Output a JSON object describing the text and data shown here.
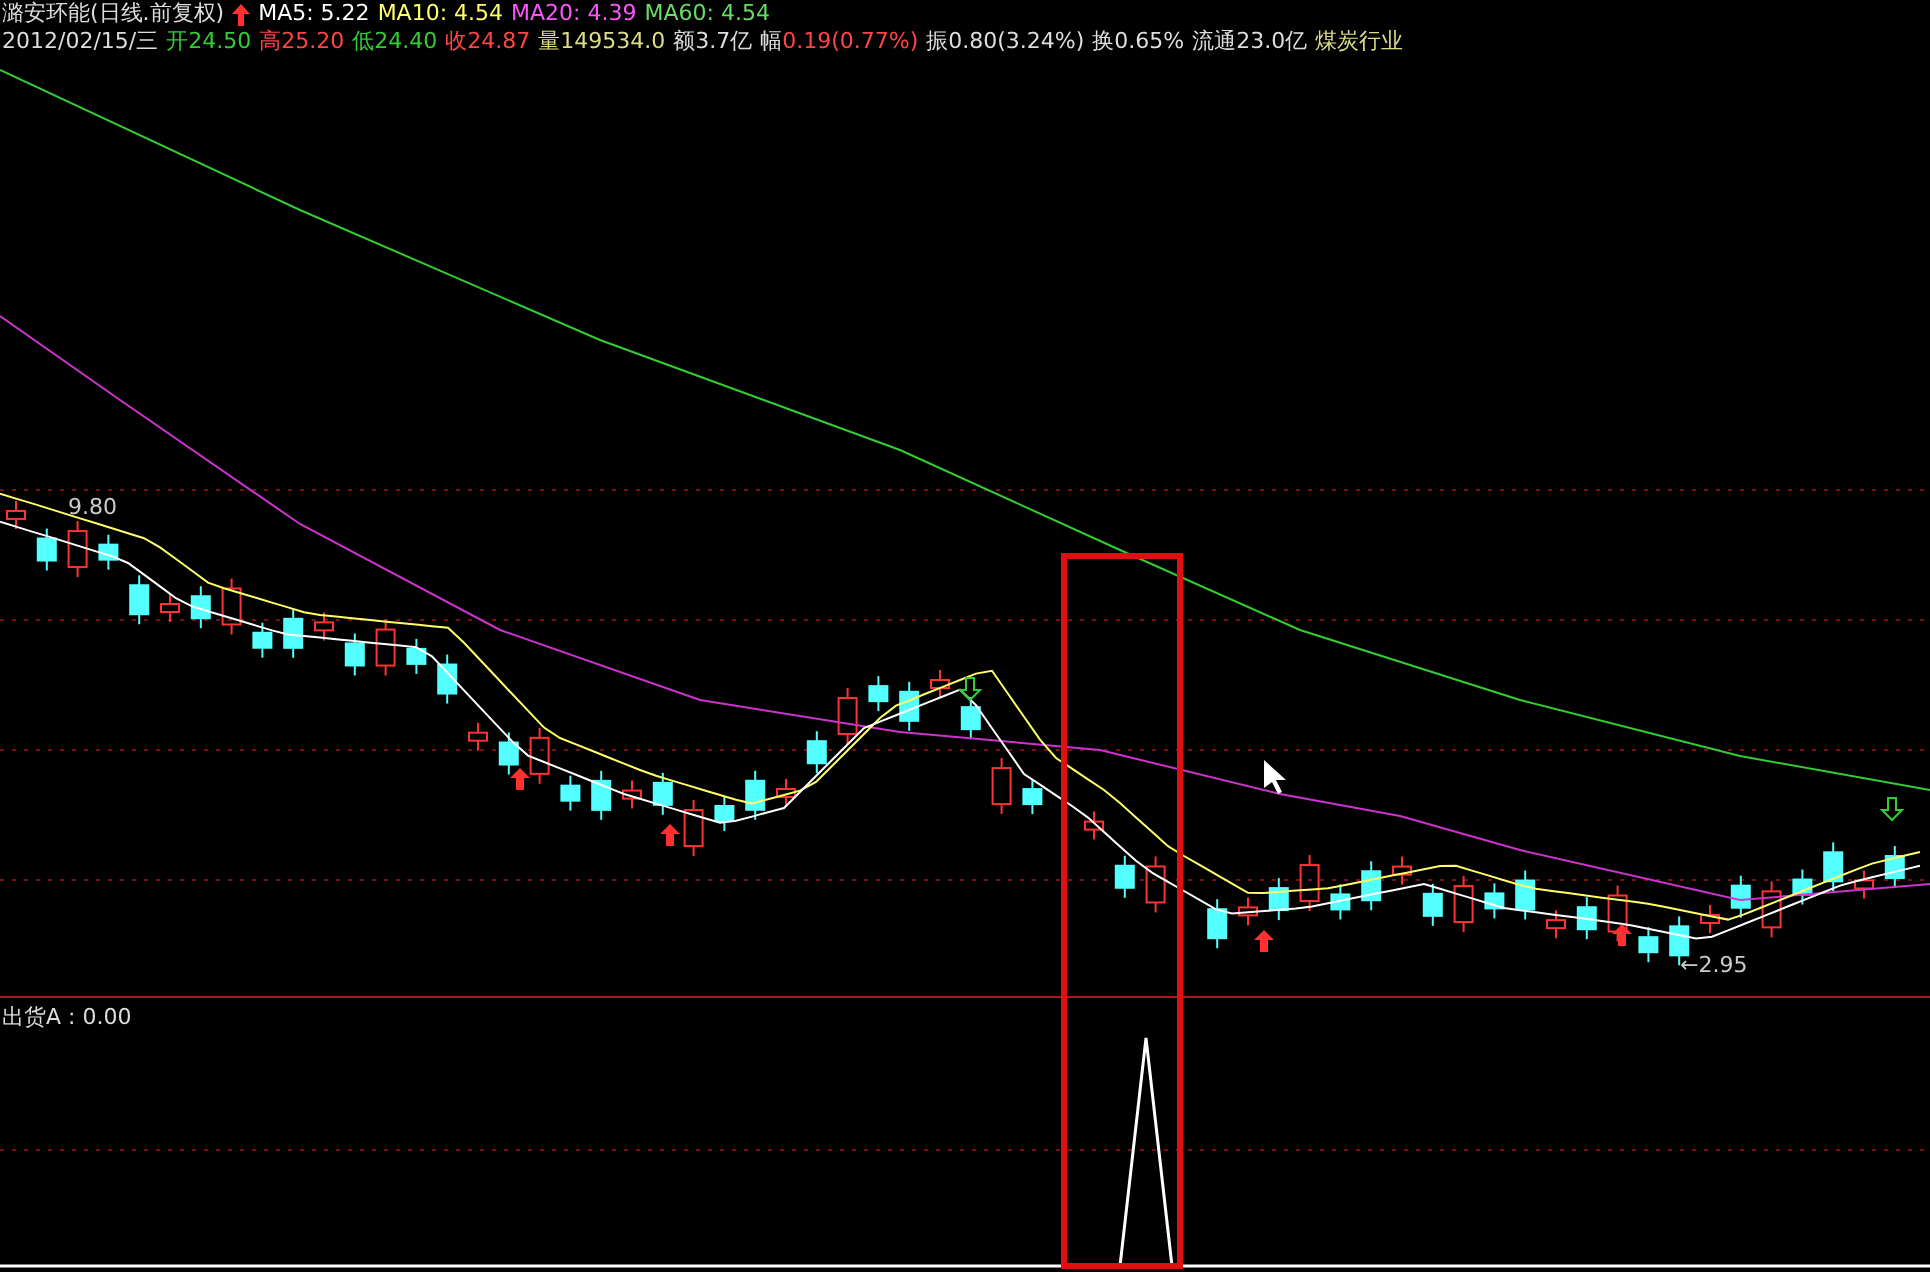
{
  "title": "潞安环能(日线.前复权)",
  "ma_legend": [
    {
      "label": "MA5: 5.22",
      "color": "#ffffff"
    },
    {
      "label": "MA10: 4.54",
      "color": "#ffff66"
    },
    {
      "label": "MA20: 4.39",
      "color": "#ff55ff"
    },
    {
      "label": "MA60: 4.54",
      "color": "#66dd66"
    }
  ],
  "date": "2012/02/15/三",
  "quote": [
    {
      "label": "开",
      "value": "24.50",
      "color": "#33cc33"
    },
    {
      "label": "高",
      "value": "25.20",
      "color": "#ff4444"
    },
    {
      "label": "低",
      "value": "24.40",
      "color": "#33cc33"
    },
    {
      "label": "收",
      "value": "24.87",
      "color": "#ff4444"
    },
    {
      "label": "量",
      "value": "149534.0",
      "color": "#dddd88"
    },
    {
      "label": "额",
      "value": "3.7亿",
      "color": "#dddddd"
    },
    {
      "label": "幅",
      "value": "0.19(0.77%)",
      "color": "#ff4444"
    },
    {
      "label": "振",
      "value": "0.80(3.24%)",
      "color": "#dddddd"
    },
    {
      "label": "换",
      "value": "0.65%",
      "color": "#dddddd"
    },
    {
      "label": "流通",
      "value": "23.0亿",
      "color": "#dddddd"
    }
  ],
  "industry": "煤炭行业",
  "price_marks": [
    {
      "text": "9.80"
    },
    {
      "text": "←2.95"
    }
  ],
  "indicator": {
    "label": "出货A : 0.00"
  }
}
